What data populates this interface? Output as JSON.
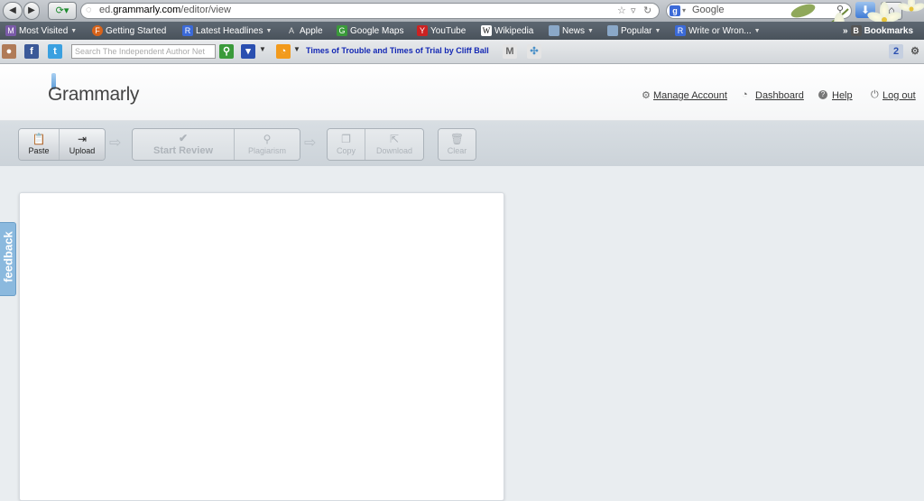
{
  "browser": {
    "url_prefix": "ed.",
    "url_domain": "grammarly.com",
    "url_path": "/editor/view",
    "search_placeholder": "Google",
    "bookmarks": [
      {
        "label": "Most Visited",
        "color": "#7a5aa8",
        "icon": "M"
      },
      {
        "label": "Getting Started",
        "color": "#d8631a",
        "icon": "F"
      },
      {
        "label": "Latest Headlines",
        "color": "#3b6ad8",
        "icon": "R"
      },
      {
        "label": "Apple",
        "color": "#bbbbbb",
        "icon": "A"
      },
      {
        "label": "Google Maps",
        "color": "#3a9a3a",
        "icon": "G"
      },
      {
        "label": "YouTube",
        "color": "#cc2222",
        "icon": "Y"
      },
      {
        "label": "Wikipedia",
        "color": "#ffffff",
        "icon": "W"
      },
      {
        "label": "News",
        "color": "#8aa8c8",
        "icon": "N"
      },
      {
        "label": "Popular",
        "color": "#8aa8c8",
        "icon": "P"
      },
      {
        "label": "Write or Wron...",
        "color": "#3b6ad8",
        "icon": "R"
      },
      {
        "label": "Bookmarks",
        "color": "#555555",
        "icon": "B"
      }
    ],
    "toolbar": {
      "site_search_placeholder": "Search The Independent Author Net",
      "ticker": "Times of Trouble and Times of Trial by Cliff Ball"
    }
  },
  "header": {
    "logo": "Grammarly",
    "links": [
      {
        "label": "Manage Account",
        "icon": "gear-icon"
      },
      {
        "label": "Dashboard",
        "icon": "gauge-icon"
      },
      {
        "label": "Help",
        "icon": "help-icon"
      },
      {
        "label": "Log out",
        "icon": "power-icon"
      }
    ]
  },
  "actions": {
    "paste": "Paste",
    "upload": "Upload",
    "start_review": "Start Review",
    "plagiarism": "Plagiarism",
    "copy": "Copy",
    "download": "Download",
    "clear": "Clear"
  },
  "feedback_label": "feedback"
}
